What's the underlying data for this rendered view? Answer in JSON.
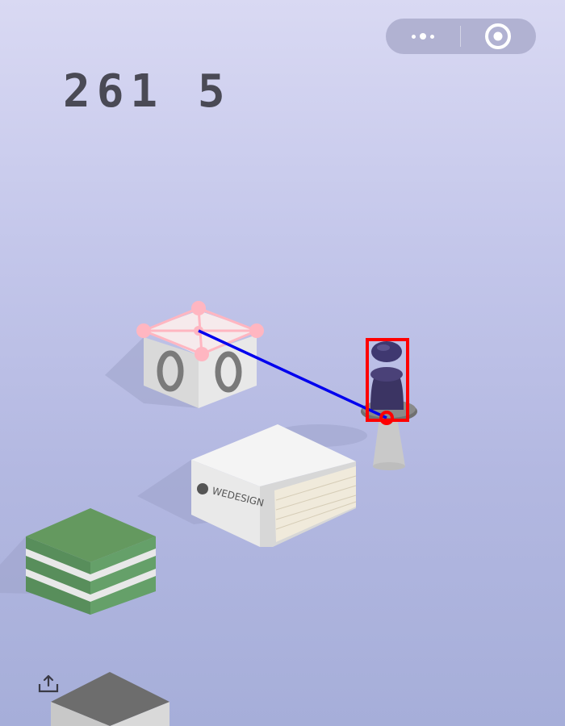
{
  "hud": {
    "score": "261 5"
  },
  "capsule": {
    "more_icon": "more-dots-icon",
    "close_icon": "target-circle-icon"
  },
  "blocks": [
    {
      "name": "speaker-box-block",
      "color": "#f2f2f2"
    },
    {
      "name": "wedesign-book-block",
      "label": "WEDESIGN",
      "color": "#f4f4f4"
    },
    {
      "name": "green-striped-block",
      "color": "#5f9a63"
    },
    {
      "name": "gray-block",
      "color": "#6d6d6d"
    }
  ],
  "overlay": {
    "target_color": "#ffb6c1",
    "trajectory_color": "#0000ee",
    "player_box_color": "#ff0000"
  },
  "colors": {
    "player": "#3b3463",
    "score": "#4a4a55"
  }
}
